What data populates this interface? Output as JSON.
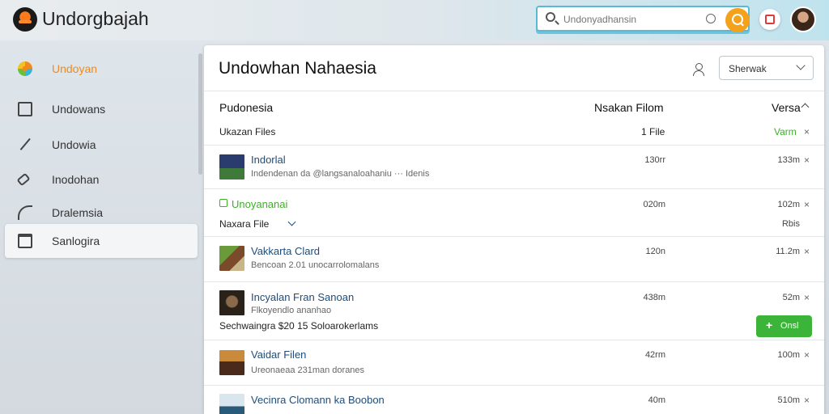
{
  "app": {
    "title": "Undorgbajah"
  },
  "search": {
    "placeholder": "Undonyadhansin"
  },
  "sidebar": {
    "items": [
      {
        "label": "Undoyan"
      },
      {
        "label": "Undowans"
      },
      {
        "label": "Undowia"
      },
      {
        "label": "Inodohan"
      },
      {
        "label": "Dralemsia"
      },
      {
        "label": "Sanlogira"
      }
    ]
  },
  "panel": {
    "title": "Undowhan Nahaesia",
    "sort": {
      "value": "Sherwak"
    },
    "columns": {
      "name": "Pudonesia",
      "size": "Nsakan Filom",
      "version": "Versa"
    },
    "group": {
      "label": "Ukazan Files",
      "count": "1 File",
      "version": "Varm"
    },
    "rows": [
      {
        "title": "Indorlal",
        "subtitle": "Indendenan da @langsanaloahaniu ··· Idenis",
        "size": "130rr",
        "right": "133m"
      },
      {
        "title": "Unoyananai",
        "size": "020m",
        "right": "102m"
      },
      {
        "title": "Naxara File",
        "right": "Rbis"
      },
      {
        "title": "Vakkarta Clard",
        "subtitle": "Bencoan 2.01 unocarrolomalans",
        "size": "120n",
        "right": "11.2m"
      },
      {
        "title": "Incyalan Fran Sanoan",
        "subtitle": "Flkoyendlo ananhao",
        "size": "438m",
        "right": "52m"
      },
      {
        "label": "Sechwaingra $20 15 Soloarokerlams"
      },
      {
        "title": "Vaidar Filen",
        "subtitle": "Ureonaeaa 231man doranes",
        "size": "42rm",
        "right": "100m"
      },
      {
        "title": "Vecinra Clomann ka Boobon",
        "size": "40m",
        "right": "510m"
      }
    ],
    "button": {
      "label": "Onsl"
    }
  }
}
